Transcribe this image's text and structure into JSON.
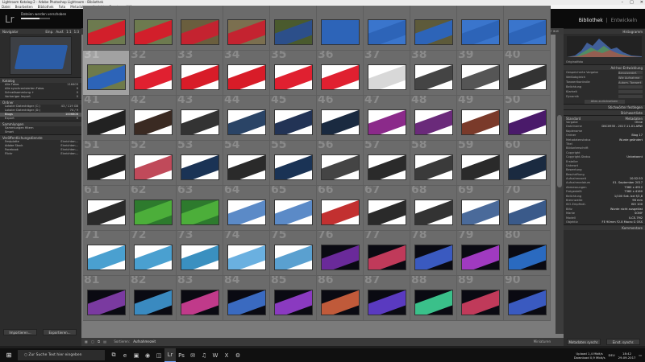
{
  "window": {
    "title": "Lightroom Katalog-2 - Adobe Photoshop Lightroom - Bibliothek",
    "controls": [
      "–",
      "□",
      "✕"
    ]
  },
  "menu": [
    "Datei",
    "Bearbeiten",
    "Bibliothek",
    "Foto",
    "Metadaten",
    "Ansicht",
    "Fenster",
    "Hilfe"
  ],
  "identity": {
    "logo": "Lr",
    "status": "Dateien werden verschoben",
    "progress": 0.65,
    "modules": [
      "Bibliothek",
      "|",
      "Entwickeln"
    ]
  },
  "left_panel": {
    "navigator": {
      "title": "Navigator",
      "zoom_options": [
        "Einp.",
        "Ausf.",
        "1:1",
        "1:3"
      ]
    },
    "catalog": {
      "title": "Katalog",
      "items": [
        {
          "label": "Alle Fotos",
          "count": "116403"
        },
        {
          "label": "Alle synchronisierten Fotos",
          "count": "0"
        },
        {
          "label": "Schnellsammlung +",
          "count": "0"
        },
        {
          "label": "Vorheriger Import",
          "count": "0"
        }
      ]
    },
    "folders": {
      "title": "Ordner",
      "items": [
        {
          "label": "Lokaler Datenträger (C:)",
          "count": "43 / 119 GB",
          "sel": false
        },
        {
          "label": "Lokaler Datenträger (D:)",
          "count": "74 / 9",
          "sel": false
        },
        {
          "label": "Blogs",
          "count": "1006808",
          "sel": true
        },
        {
          "label": "Export",
          "count": "0",
          "sel": false
        }
      ]
    },
    "collections": {
      "title": "Sammlungen",
      "items": [
        {
          "label": "Sammlungen filtern",
          "count": ""
        },
        {
          "label": "Smart",
          "count": ""
        }
      ]
    },
    "publish": {
      "title": "Veröffentlichungsdienste",
      "items": [
        {
          "label": "Festplatte",
          "count": "Einrichten..."
        },
        {
          "label": "Adobe Stock",
          "count": "Einrichten..."
        },
        {
          "label": "Facebook",
          "count": "Einrichten..."
        },
        {
          "label": "Flickr",
          "count": "Einrichten..."
        }
      ]
    },
    "import_button": "Importieren...",
    "export_button": "Exportieren..."
  },
  "center": {
    "filter_bar": {
      "label": "Bibliotheksfilter:",
      "filters": [
        "Text",
        "Attribut",
        "Metadaten",
        "Ohne"
      ],
      "preset": "Filter aus"
    },
    "toolbar": {
      "sort_label": "Sortieren:",
      "sort_value": "Aufnahmezeit",
      "thumbs_label": "Miniaturen"
    }
  },
  "right_panel": {
    "histogram": {
      "title": "Histogramm",
      "info": "Originalfoto"
    },
    "quick_develop": {
      "title": "Ad-hoc-Entwicklung",
      "rows": [
        {
          "label": "Gespeicherte Vorgabe",
          "value": "Benutzerdef."
        },
        {
          "label": "Weißabgleich",
          "value": "Wie Aufnahme"
        },
        {
          "label": "Tonwertkontrolle",
          "value": "Autom. Tonwert"
        },
        {
          "label": "Belichtung",
          "value": ""
        },
        {
          "label": "Klarheit",
          "value": ""
        },
        {
          "label": "Dynamik",
          "value": ""
        }
      ],
      "reset": "Alles zurücksetzen"
    },
    "keywording": {
      "title": "Stichwörter festlegen"
    },
    "keyword_list": {
      "title": "Stichwortliste"
    },
    "metadata": {
      "title": "Metadaten",
      "preset_label": "Standard",
      "rows": [
        {
          "label": "Vorgabe",
          "value": "Ohne"
        },
        {
          "label": "Dateiname",
          "value": "DSC0935 - 2017-11-01.ARW"
        },
        {
          "label": "Kopiename",
          "value": ""
        },
        {
          "label": "Ordner",
          "value": "Blog 17"
        },
        {
          "label": "Metadatenstatus",
          "value": "Wurde geändert"
        },
        {
          "label": "Titel",
          "value": ""
        },
        {
          "label": "Bildunterschrift",
          "value": ""
        },
        {
          "label": "Copyright",
          "value": ""
        },
        {
          "label": "Copyright-Status",
          "value": "Unbekannt"
        },
        {
          "label": "Ersteller",
          "value": ""
        },
        {
          "label": "Unterort",
          "value": ""
        },
        {
          "label": "Bewertung",
          "value": ""
        },
        {
          "label": "Beschriftung",
          "value": ""
        },
        {
          "label": "Aufnahmezeit",
          "value": "10:52:53"
        },
        {
          "label": "Aufnahmedatum",
          "value": "01. September 2017"
        },
        {
          "label": "Abmessungen",
          "value": "7360 x 4912"
        },
        {
          "label": "Freigestellt",
          "value": "7360 x 4160"
        },
        {
          "label": "Belichtung",
          "value": "1/100 Sek. bei f/2,8"
        },
        {
          "label": "Brennweite",
          "value": "96 mm"
        },
        {
          "label": "ISO-Empfindl.",
          "value": "ISO 100"
        },
        {
          "label": "Blitz",
          "value": "Wurde nicht ausgelöst"
        },
        {
          "label": "Marke",
          "value": "SONY"
        },
        {
          "label": "Modell",
          "value": "ILCE-7M2"
        },
        {
          "label": "Objektiv",
          "value": "FE 90mm F2.8 Macro G OSS"
        }
      ]
    },
    "comments": {
      "title": "Kommentare"
    },
    "sync_button": "Metadaten synchr.",
    "sync_settings_button": "Einst. synchr."
  },
  "grid": {
    "cells": [
      {
        "n": "",
        "c1": "#d21f2b",
        "c2": "#6d7a4f"
      },
      {
        "n": "",
        "c1": "#d21f2b",
        "c2": "#6d7a4f"
      },
      {
        "n": "",
        "c1": "#c42330",
        "c2": "#6a5e3e"
      },
      {
        "n": "",
        "c1": "#c42330",
        "c2": "#7b6f4f"
      },
      {
        "n": "",
        "c1": "#2c4f8a",
        "c2": "#4a5a2e"
      },
      {
        "n": "",
        "c1": "#2d64b8",
        "c2": "#2d64b8"
      },
      {
        "n": "",
        "c1": "#2d64b8",
        "c2": "#3a75cc"
      },
      {
        "n": "",
        "c1": "#2d64b8",
        "c2": "#5d5a3a"
      },
      {
        "n": "",
        "c1": "#2d64b8",
        "c2": "#3a75cc"
      },
      {
        "n": "",
        "c1": "#2d64b8",
        "c2": "#3a75cc"
      },
      {
        "n": "31",
        "c1": "#2d64b8",
        "c2": "#6e7a4a",
        "sel": true
      },
      {
        "n": "32",
        "c1": "#e02030",
        "c2": "#ffffff"
      },
      {
        "n": "33",
        "c1": "#d81c28",
        "c2": "#ffffff"
      },
      {
        "n": "34",
        "c1": "#d81c28",
        "c2": "#ffffff"
      },
      {
        "n": "35",
        "c1": "#e02030",
        "c2": "#ffffff"
      },
      {
        "n": "36",
        "c1": "#e02030",
        "c2": "#ffffff"
      },
      {
        "n": "37",
        "c1": "#d8d8d8",
        "c2": "#ffffff"
      },
      {
        "n": "38",
        "c1": "#444444",
        "c2": "#ffffff"
      },
      {
        "n": "39",
        "c1": "#555555",
        "c2": "#ffffff"
      },
      {
        "n": "40",
        "c1": "#333333",
        "c2": "#ffffff"
      },
      {
        "n": "41",
        "c1": "#222222",
        "c2": "#ffffff"
      },
      {
        "n": "42",
        "c1": "#3a2a22",
        "c2": "#ffffff"
      },
      {
        "n": "43",
        "c1": "#333333",
        "c2": "#ffffff"
      },
      {
        "n": "44",
        "c1": "#2a4466",
        "c2": "#ffffff"
      },
      {
        "n": "45",
        "c1": "#223355",
        "c2": "#ffffff"
      },
      {
        "n": "46",
        "c1": "#1a2a40",
        "c2": "#ffffff"
      },
      {
        "n": "47",
        "c1": "#8b2a8a",
        "c2": "#ffffff"
      },
      {
        "n": "48",
        "c1": "#6a2a7a",
        "c2": "#ffffff"
      },
      {
        "n": "49",
        "c1": "#7a3a2a",
        "c2": "#ffffff"
      },
      {
        "n": "50",
        "c1": "#4a1a6a",
        "c2": "#ffffff"
      },
      {
        "n": "51",
        "c1": "#222222",
        "c2": "#ffffff"
      },
      {
        "n": "52",
        "c1": "#c04a5a",
        "c2": "#ffffff"
      },
      {
        "n": "53",
        "c1": "#1a3355",
        "c2": "#ffffff"
      },
      {
        "n": "54",
        "c1": "#2a2a2a",
        "c2": "#ffffff"
      },
      {
        "n": "55",
        "c1": "#1a3355",
        "c2": "#ffffff"
      },
      {
        "n": "56",
        "c1": "#444444",
        "c2": "#ffffff"
      },
      {
        "n": "57",
        "c1": "#2a2a2a",
        "c2": "#ffffff"
      },
      {
        "n": "58",
        "c1": "#3a3a3a",
        "c2": "#ffffff"
      },
      {
        "n": "59",
        "c1": "#2a2a2a",
        "c2": "#ffffff"
      },
      {
        "n": "60",
        "c1": "#1a2a40",
        "c2": "#ffffff"
      },
      {
        "n": "61",
        "c1": "#2a2a2a",
        "c2": "#ffffff"
      },
      {
        "n": "62",
        "c1": "#4cae3a",
        "c2": "#2d7a2d"
      },
      {
        "n": "63",
        "c1": "#4cae3a",
        "c2": "#2d7a2d"
      },
      {
        "n": "64",
        "c1": "#5b8ac7",
        "c2": "#ffffff"
      },
      {
        "n": "65",
        "c1": "#5b8ac7",
        "c2": "#ffffff"
      },
      {
        "n": "66",
        "c1": "#c23030",
        "c2": "#ffffff"
      },
      {
        "n": "67",
        "c1": "#2a2a2a",
        "c2": "#ffffff"
      },
      {
        "n": "68",
        "c1": "#333333",
        "c2": "#ffffff"
      },
      {
        "n": "69",
        "c1": "#4a6a9a",
        "c2": "#ffffff"
      },
      {
        "n": "70",
        "c1": "#3a5a8a",
        "c2": "#ffffff"
      },
      {
        "n": "71",
        "c1": "#4aa0d0",
        "c2": "#ffffff"
      },
      {
        "n": "72",
        "c1": "#4aa0d0",
        "c2": "#ffffff"
      },
      {
        "n": "73",
        "c1": "#3a90c0",
        "c2": "#ffffff"
      },
      {
        "n": "74",
        "c1": "#6ab0e0",
        "c2": "#ffffff"
      },
      {
        "n": "75",
        "c1": "#5aa0d0",
        "c2": "#ffffff"
      },
      {
        "n": "76",
        "c1": "#6a2a9a",
        "c2": "#0a0a12"
      },
      {
        "n": "77",
        "c1": "#c03a5a",
        "c2": "#0a0a12"
      },
      {
        "n": "78",
        "c1": "#3a5ac0",
        "c2": "#0a0a12"
      },
      {
        "n": "79",
        "c1": "#a03ac0",
        "c2": "#0a0a12"
      },
      {
        "n": "80",
        "c1": "#2a6ac0",
        "c2": "#0a0a12"
      },
      {
        "n": "81",
        "c1": "#7a3aa0",
        "c2": "#0a0a12"
      },
      {
        "n": "82",
        "c1": "#3a8ac0",
        "c2": "#0a0a12"
      },
      {
        "n": "83",
        "c1": "#c03a8a",
        "c2": "#0a0a12"
      },
      {
        "n": "84",
        "c1": "#3a6ac0",
        "c2": "#0a0a12"
      },
      {
        "n": "85",
        "c1": "#8a3ac0",
        "c2": "#0a0a12"
      },
      {
        "n": "86",
        "c1": "#c05a3a",
        "c2": "#0a0a12"
      },
      {
        "n": "87",
        "c1": "#5a3ac0",
        "c2": "#0a0a12"
      },
      {
        "n": "88",
        "c1": "#3ac08a",
        "c2": "#0a0a12"
      },
      {
        "n": "89",
        "c1": "#c03a5a",
        "c2": "#0a0a12"
      },
      {
        "n": "90",
        "c1": "#3a5ac0",
        "c2": "#0a0a12"
      }
    ]
  },
  "taskbar": {
    "search_placeholder": "Zur Suche Text hier eingeben",
    "apps": [
      "task-view",
      "edge",
      "explorer",
      "chrome",
      "store",
      "lightroom",
      "photoshop",
      "mail",
      "spotify",
      "word",
      "excel",
      "tool"
    ],
    "tray": {
      "network": "Upload 1,4 Mbit/s",
      "net2": "Download 0,9 Mbit/s",
      "lang": "DEU",
      "time": "18:42",
      "date": "29.09.2017"
    }
  },
  "colors": {
    "accent": "#3b8ae0",
    "panel": "#2c2c2c",
    "grid_bg": "#6b6b6b"
  }
}
